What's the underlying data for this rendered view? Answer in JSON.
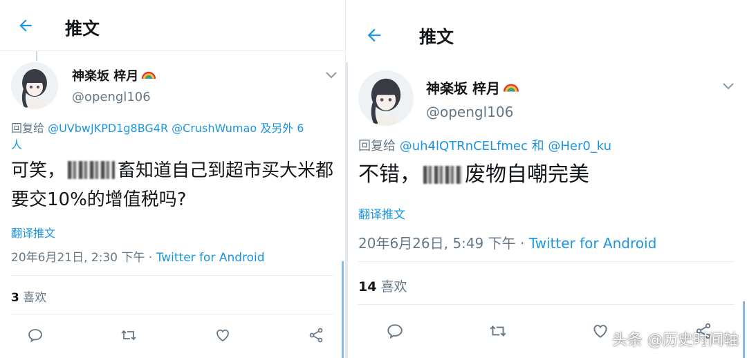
{
  "left_tweet": {
    "header_title": "推文",
    "name": "神楽坂 梓月",
    "handle": "@opengl106",
    "reply_prefix": "回复给 ",
    "reply_mentions": "@UVbwJKPD1g8BG4R @CrushWumao 及另外 6",
    "reply_suffix": "人",
    "text_before": "可笑，",
    "text_after": "畜知道自己到超市买大米都要交10%的增值税吗?",
    "translate": "翻译推文",
    "date": "20年6月21日, 2:30 下午 · ",
    "client": "Twitter for Android",
    "likes_count": "3",
    "likes_label": "喜欢"
  },
  "right_tweet": {
    "header_title": "推文",
    "name": "神楽坂 梓月",
    "handle": "@opengl106",
    "reply_prefix": "回复给 ",
    "reply_mentions": "@uh4lQTRnCELfmec 和 @Her0_ku",
    "text_before": "不错，",
    "text_after": "废物自嘲完美",
    "translate": "翻译推文",
    "date": "20年6月26日, 5:49 下午 · ",
    "client": "Twitter for Android",
    "likes_count": "14",
    "likes_label": "喜欢"
  },
  "watermark": "头条 @历史时间轴",
  "colors": {
    "accent": "#1b95e0",
    "secondary_text": "#657786",
    "divider": "#e6ecf0"
  },
  "icons": [
    "back-arrow-icon",
    "rainbow-icon",
    "chevron-down-icon",
    "reply-icon",
    "retweet-icon",
    "like-icon",
    "share-icon"
  ]
}
